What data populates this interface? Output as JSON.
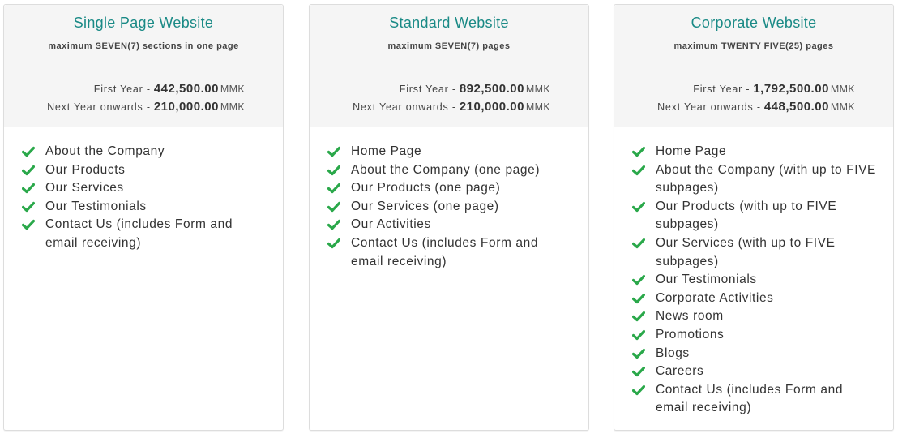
{
  "colors": {
    "title": "#1a8a86",
    "check": "#2aa84a",
    "header_bg": "#f5f5f5",
    "border": "#dddddd"
  },
  "plans": [
    {
      "title": "Single Page Website",
      "subtitle": "maximum SEVEN(7) sections in one page",
      "first_year_label": "First Year -",
      "first_year_price": "442,500.00",
      "next_year_label": "Next Year onwards -",
      "next_year_price": "210,000.00",
      "currency": "MMK",
      "features": [
        "About the Company",
        "Our Products",
        "Our Services",
        "Our Testimonials",
        "Contact Us (includes Form and email receiving)"
      ]
    },
    {
      "title": "Standard Website",
      "subtitle": "maximum SEVEN(7) pages",
      "first_year_label": "First Year -",
      "first_year_price": "892,500.00",
      "next_year_label": "Next Year onwards -",
      "next_year_price": "210,000.00",
      "currency": "MMK",
      "features": [
        "Home Page",
        "About the Company (one page)",
        "Our Products (one page)",
        "Our Services (one page)",
        "Our Activities",
        "Contact Us (includes Form and email receiving)"
      ]
    },
    {
      "title": "Corporate Website",
      "subtitle": "maximum TWENTY FIVE(25) pages",
      "first_year_label": "First Year -",
      "first_year_price": "1,792,500.00",
      "next_year_label": "Next Year onwards -",
      "next_year_price": "448,500.00",
      "currency": "MMK",
      "features": [
        "Home Page",
        "About the Company (with up to FIVE subpages)",
        "Our Products (with up to FIVE subpages)",
        "Our Services (with up to FIVE subpages)",
        "Our Testimonials",
        "Corporate Activities",
        "News room",
        "Promotions",
        "Blogs",
        "Careers",
        "Contact Us (includes Form and email receiving)"
      ]
    }
  ]
}
